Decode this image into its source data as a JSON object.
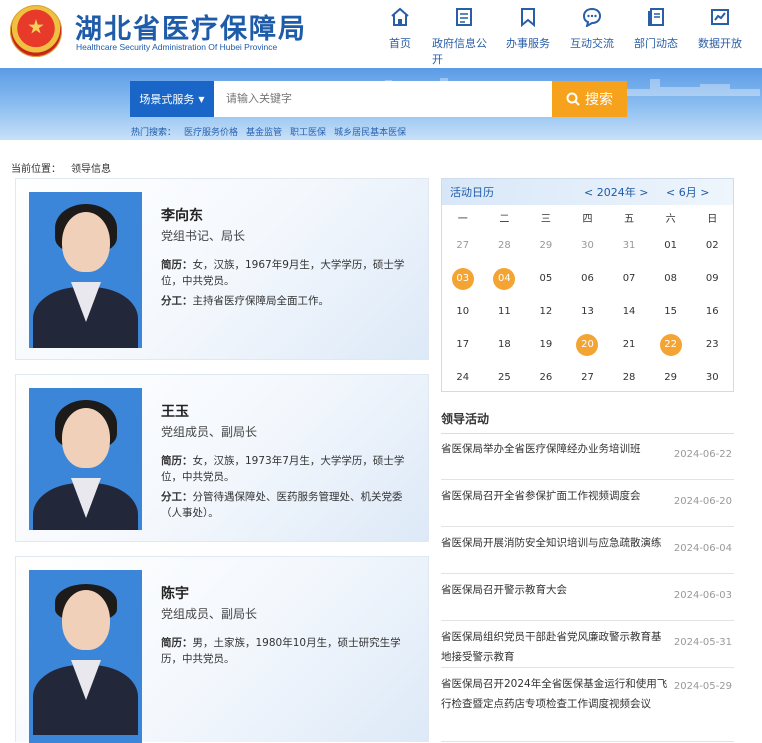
{
  "header": {
    "title": "湖北省医疗保障局",
    "subtitle": "Healthcare Security Administration Of Hubei Province",
    "nav": [
      {
        "label": "首页",
        "icon": "home-icon"
      },
      {
        "label": "政府信息公开",
        "icon": "document-icon"
      },
      {
        "label": "办事服务",
        "icon": "bookmark-icon"
      },
      {
        "label": "互动交流",
        "icon": "chat-icon"
      },
      {
        "label": "部门动态",
        "icon": "news-icon"
      },
      {
        "label": "数据开放",
        "icon": "chart-icon"
      }
    ]
  },
  "search": {
    "scope": "场景式服务",
    "placeholder": "请输入关键字",
    "button": "搜索",
    "hot_label": "热门搜索：",
    "hot": [
      "医疗服务价格",
      "基金监管",
      "职工医保",
      "城乡居民基本医保"
    ]
  },
  "breadcrumb": {
    "label": "当前位置：",
    "current": "领导信息"
  },
  "leaders": [
    {
      "name": "李向东",
      "position": "党组书记、局长",
      "bio_label": "简历：",
      "bio": "女，汉族，1967年9月生，大学学历，硕士学位，中共党员。",
      "duty_label": "分工：",
      "duty": "主持省医疗保障局全面工作。"
    },
    {
      "name": "王玉",
      "position": "党组成员、副局长",
      "bio_label": "简历：",
      "bio": "女，汉族，1973年7月生，大学学历，硕士学位，中共党员。",
      "duty_label": "分工：",
      "duty": "分管待遇保障处、医药服务管理处、机关党委（人事处）。"
    },
    {
      "name": "陈宇",
      "position": "党组成员、副局长",
      "bio_label": "简历：",
      "bio": "男，土家族，1980年10月生，硕士研究生学历，中共党员。"
    }
  ],
  "calendar": {
    "title": "活动日历",
    "year": "< 2024年 >",
    "month": "< 6月 >",
    "weekdays": [
      "一",
      "二",
      "三",
      "四",
      "五",
      "六",
      "日"
    ],
    "days": [
      {
        "d": "27",
        "dim": true
      },
      {
        "d": "28",
        "dim": true
      },
      {
        "d": "29",
        "dim": true
      },
      {
        "d": "30",
        "dim": true
      },
      {
        "d": "31",
        "dim": true
      },
      {
        "d": "01"
      },
      {
        "d": "02"
      },
      {
        "d": "03",
        "hl": true
      },
      {
        "d": "04",
        "hl": true
      },
      {
        "d": "05"
      },
      {
        "d": "06"
      },
      {
        "d": "07"
      },
      {
        "d": "08"
      },
      {
        "d": "09"
      },
      {
        "d": "10"
      },
      {
        "d": "11"
      },
      {
        "d": "12"
      },
      {
        "d": "13"
      },
      {
        "d": "14"
      },
      {
        "d": "15"
      },
      {
        "d": "16"
      },
      {
        "d": "17"
      },
      {
        "d": "18"
      },
      {
        "d": "19"
      },
      {
        "d": "20",
        "hl": true
      },
      {
        "d": "21"
      },
      {
        "d": "22",
        "hl": true
      },
      {
        "d": "23"
      },
      {
        "d": "24"
      },
      {
        "d": "25"
      },
      {
        "d": "26"
      },
      {
        "d": "27"
      },
      {
        "d": "28"
      },
      {
        "d": "29"
      },
      {
        "d": "30"
      }
    ]
  },
  "activities": {
    "title": "领导活动",
    "items": [
      {
        "text": "省医保局举办全省医疗保障经办业务培训班",
        "date": "2024-06-22"
      },
      {
        "text": "省医保局召开全省参保扩面工作视频调度会",
        "date": "2024-06-20"
      },
      {
        "text": "省医保局开展消防安全知识培训与应急疏散演练",
        "date": "2024-06-04"
      },
      {
        "text": "省医保局召开警示教育大会",
        "date": "2024-06-03"
      },
      {
        "text": "省医保局组织党员干部赴省党风廉政警示教育基地接受警示教育",
        "date": "2024-05-31"
      },
      {
        "text": "省医保局召开2024年全省医保基金运行和使用飞行检查暨定点药店专项检查工作调度视频会议",
        "date": "2024-05-29"
      }
    ]
  },
  "colors": {
    "brand": "#1e5ba8",
    "accent": "#f7a21c",
    "highlight": "#f3a433"
  }
}
